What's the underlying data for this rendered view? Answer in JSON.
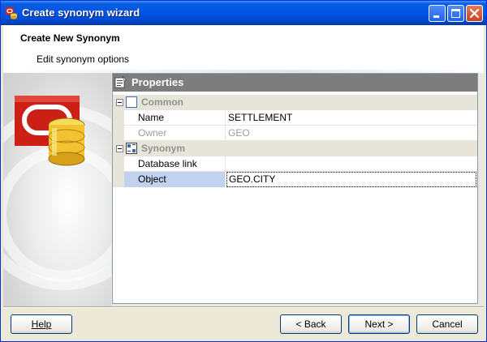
{
  "window": {
    "title": "Create synonym wizard"
  },
  "header": {
    "title": "Create New Synonym",
    "subtitle": "Edit synonym options"
  },
  "properties": {
    "title": "Properties",
    "categories": [
      {
        "label": "Common",
        "rows": [
          {
            "name": "Name",
            "value": "SETTLEMENT",
            "disabled": false,
            "selected": false
          },
          {
            "name": "Owner",
            "value": "GEO",
            "disabled": true,
            "selected": false
          }
        ]
      },
      {
        "label": "Synonym",
        "rows": [
          {
            "name": "Database link",
            "value": "",
            "disabled": false,
            "selected": false
          },
          {
            "name": "Object",
            "value": "GEO.CITY",
            "disabled": false,
            "selected": true
          }
        ]
      }
    ]
  },
  "buttons": {
    "help": "Help",
    "back": "< Back",
    "next": "Next >",
    "cancel": "Cancel"
  },
  "icons": {
    "app": "oracle-synonym-icon",
    "properties": "properties-icon",
    "common": "common-category-icon",
    "synonym": "synonym-category-icon",
    "minimize": "minimize-icon",
    "maximize": "maximize-icon",
    "close": "close-icon",
    "wizard": "oracle-database-icon"
  },
  "colors": {
    "titlebar": "#0055e5",
    "accent_red": "#cc1f16",
    "selection": "#c1d2ee"
  }
}
